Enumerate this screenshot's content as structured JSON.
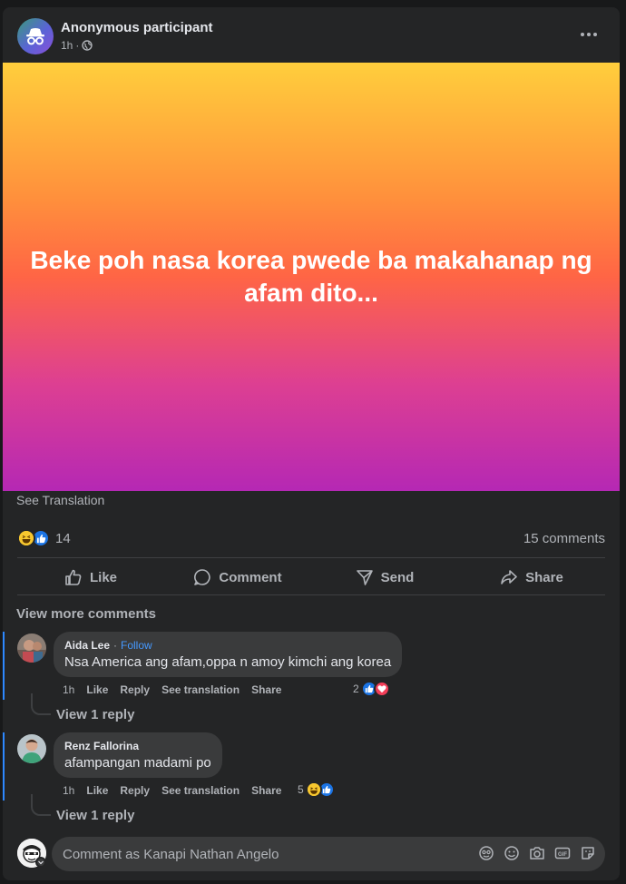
{
  "post": {
    "author": "Anonymous participant",
    "time": "1h",
    "separator": "·",
    "privacy_icon": "globe-icon",
    "text": "Beke poh nasa korea pwede ba makahanap ng afam dito...",
    "see_translation": "See Translation",
    "reaction_count": "14",
    "reaction_types": [
      "haha",
      "like"
    ],
    "comment_count": "15 comments",
    "background_gradient": [
      "#ffce3c",
      "#ff8f3c",
      "#ff6545",
      "#dd3f92",
      "#b528b4"
    ]
  },
  "actions": {
    "like": "Like",
    "comment": "Comment",
    "send": "Send",
    "share": "Share"
  },
  "view_more_comments": "View more comments",
  "comments": [
    {
      "name": "Aida Lee",
      "follow": "Follow",
      "text": "Nsa America ang afam,oppa n amoy kimchi ang korea",
      "time": "1h",
      "like": "Like",
      "reply": "Reply",
      "see_translation": "See translation",
      "share": "Share",
      "reaction_count": "2",
      "reaction_types": [
        "like",
        "love"
      ],
      "view_reply": "View 1 reply"
    },
    {
      "name": "Renz Fallorina",
      "text": "afampangan madami po",
      "time": "1h",
      "like": "Like",
      "reply": "Reply",
      "see_translation": "See translation",
      "share": "Share",
      "reaction_count": "5",
      "reaction_types": [
        "haha",
        "like"
      ],
      "view_reply": "View 1 reply"
    }
  ],
  "composer": {
    "placeholder": "Comment as Kanapi Nathan Angelo",
    "icons": [
      "avatar-sticker-icon",
      "emoji-icon",
      "camera-icon",
      "gif-icon",
      "sticker-icon"
    ]
  },
  "colors": {
    "surface": "#242526",
    "bubble": "#3a3b3c",
    "accent": "#2d88ff",
    "like_blue": "#1b74e4",
    "love_red": "#f33e58",
    "haha_yellow": "#f7c72f"
  }
}
